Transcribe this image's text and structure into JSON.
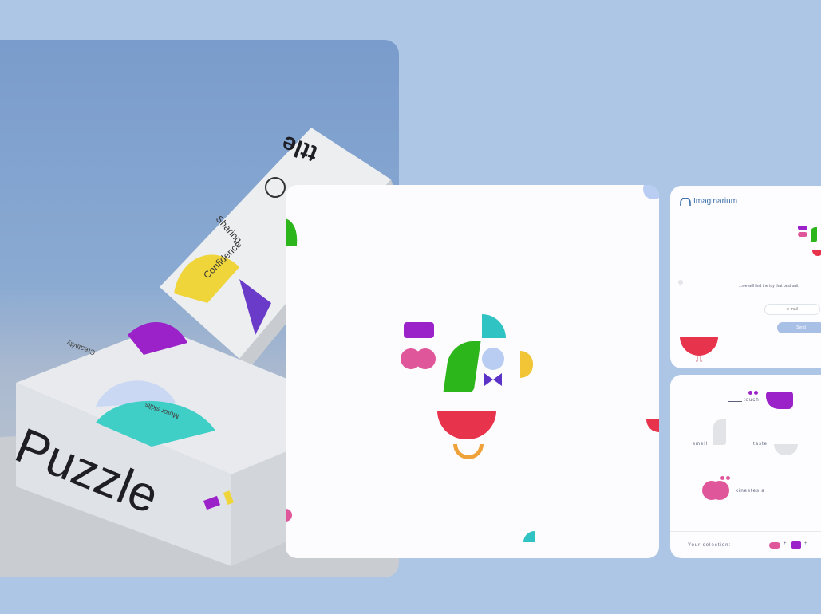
{
  "colors": {
    "background": "#adc6e5",
    "purple": "#9b22c9",
    "pink": "#e0569a",
    "green": "#2db51c",
    "teal": "#2fc4c3",
    "yellow": "#f2c536",
    "red": "#e8334c",
    "orange": "#f0a23a",
    "light_blue": "#b9cdf2",
    "indigo": "#5b33c7"
  },
  "photo": {
    "box_brand_text": "Puzzle",
    "box_top_labels": [
      "Creativity",
      "Motor skills"
    ],
    "card_labels": [
      "Sharing",
      "Confidence"
    ],
    "card_top_text": "ttle"
  },
  "app_screen": {
    "logo_text": "Imaginarium",
    "tagline": "...we will find the toy that best suit",
    "input_placeholder": "e-mail",
    "button_label": "Send"
  },
  "sense_screen": {
    "senses": [
      "touch",
      "smell",
      "taste",
      "kinestesia"
    ],
    "selection_label": "Your selection:"
  }
}
